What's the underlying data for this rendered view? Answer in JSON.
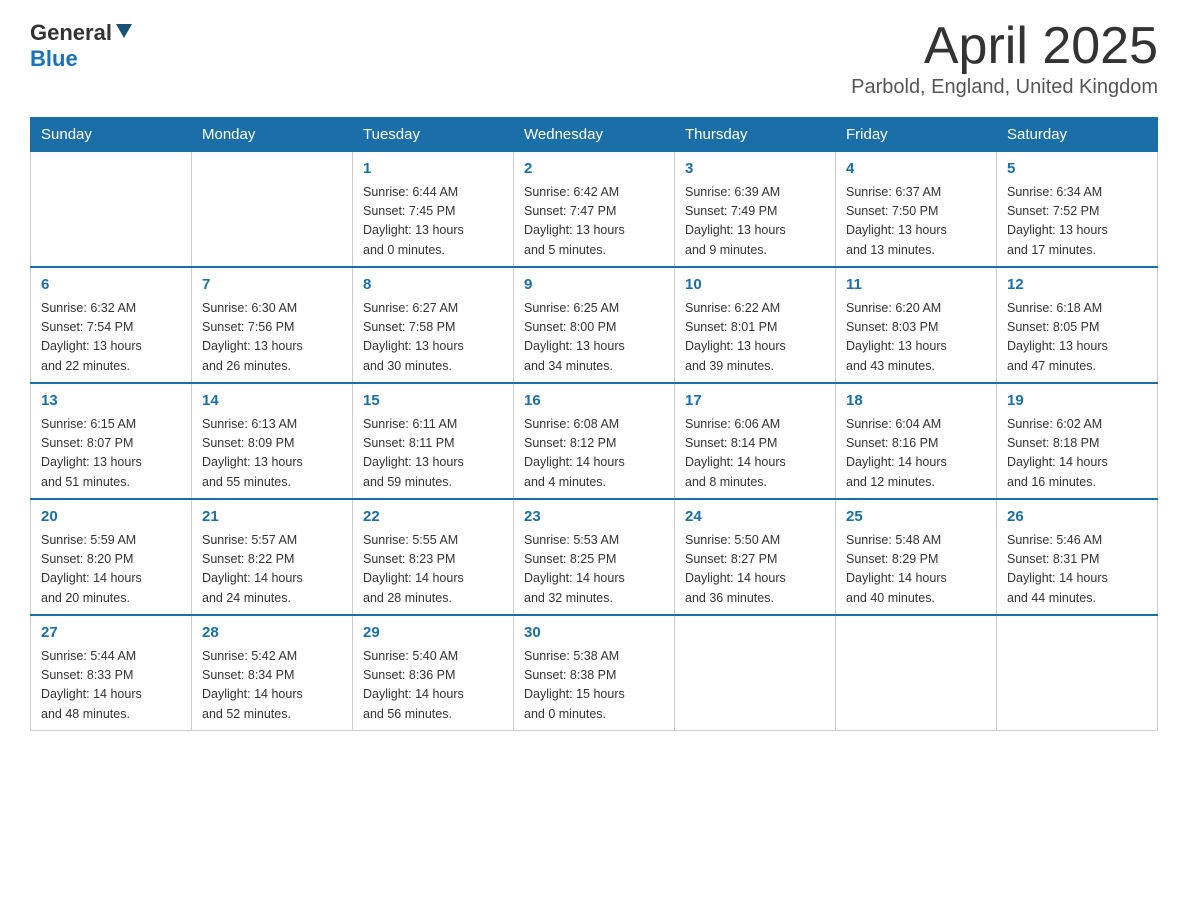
{
  "header": {
    "logo_general": "General",
    "logo_blue": "Blue",
    "month_title": "April 2025",
    "location": "Parbold, England, United Kingdom"
  },
  "days_of_week": [
    "Sunday",
    "Monday",
    "Tuesday",
    "Wednesday",
    "Thursday",
    "Friday",
    "Saturday"
  ],
  "weeks": [
    [
      {
        "day": "",
        "info": ""
      },
      {
        "day": "",
        "info": ""
      },
      {
        "day": "1",
        "info": "Sunrise: 6:44 AM\nSunset: 7:45 PM\nDaylight: 13 hours\nand 0 minutes."
      },
      {
        "day": "2",
        "info": "Sunrise: 6:42 AM\nSunset: 7:47 PM\nDaylight: 13 hours\nand 5 minutes."
      },
      {
        "day": "3",
        "info": "Sunrise: 6:39 AM\nSunset: 7:49 PM\nDaylight: 13 hours\nand 9 minutes."
      },
      {
        "day": "4",
        "info": "Sunrise: 6:37 AM\nSunset: 7:50 PM\nDaylight: 13 hours\nand 13 minutes."
      },
      {
        "day": "5",
        "info": "Sunrise: 6:34 AM\nSunset: 7:52 PM\nDaylight: 13 hours\nand 17 minutes."
      }
    ],
    [
      {
        "day": "6",
        "info": "Sunrise: 6:32 AM\nSunset: 7:54 PM\nDaylight: 13 hours\nand 22 minutes."
      },
      {
        "day": "7",
        "info": "Sunrise: 6:30 AM\nSunset: 7:56 PM\nDaylight: 13 hours\nand 26 minutes."
      },
      {
        "day": "8",
        "info": "Sunrise: 6:27 AM\nSunset: 7:58 PM\nDaylight: 13 hours\nand 30 minutes."
      },
      {
        "day": "9",
        "info": "Sunrise: 6:25 AM\nSunset: 8:00 PM\nDaylight: 13 hours\nand 34 minutes."
      },
      {
        "day": "10",
        "info": "Sunrise: 6:22 AM\nSunset: 8:01 PM\nDaylight: 13 hours\nand 39 minutes."
      },
      {
        "day": "11",
        "info": "Sunrise: 6:20 AM\nSunset: 8:03 PM\nDaylight: 13 hours\nand 43 minutes."
      },
      {
        "day": "12",
        "info": "Sunrise: 6:18 AM\nSunset: 8:05 PM\nDaylight: 13 hours\nand 47 minutes."
      }
    ],
    [
      {
        "day": "13",
        "info": "Sunrise: 6:15 AM\nSunset: 8:07 PM\nDaylight: 13 hours\nand 51 minutes."
      },
      {
        "day": "14",
        "info": "Sunrise: 6:13 AM\nSunset: 8:09 PM\nDaylight: 13 hours\nand 55 minutes."
      },
      {
        "day": "15",
        "info": "Sunrise: 6:11 AM\nSunset: 8:11 PM\nDaylight: 13 hours\nand 59 minutes."
      },
      {
        "day": "16",
        "info": "Sunrise: 6:08 AM\nSunset: 8:12 PM\nDaylight: 14 hours\nand 4 minutes."
      },
      {
        "day": "17",
        "info": "Sunrise: 6:06 AM\nSunset: 8:14 PM\nDaylight: 14 hours\nand 8 minutes."
      },
      {
        "day": "18",
        "info": "Sunrise: 6:04 AM\nSunset: 8:16 PM\nDaylight: 14 hours\nand 12 minutes."
      },
      {
        "day": "19",
        "info": "Sunrise: 6:02 AM\nSunset: 8:18 PM\nDaylight: 14 hours\nand 16 minutes."
      }
    ],
    [
      {
        "day": "20",
        "info": "Sunrise: 5:59 AM\nSunset: 8:20 PM\nDaylight: 14 hours\nand 20 minutes."
      },
      {
        "day": "21",
        "info": "Sunrise: 5:57 AM\nSunset: 8:22 PM\nDaylight: 14 hours\nand 24 minutes."
      },
      {
        "day": "22",
        "info": "Sunrise: 5:55 AM\nSunset: 8:23 PM\nDaylight: 14 hours\nand 28 minutes."
      },
      {
        "day": "23",
        "info": "Sunrise: 5:53 AM\nSunset: 8:25 PM\nDaylight: 14 hours\nand 32 minutes."
      },
      {
        "day": "24",
        "info": "Sunrise: 5:50 AM\nSunset: 8:27 PM\nDaylight: 14 hours\nand 36 minutes."
      },
      {
        "day": "25",
        "info": "Sunrise: 5:48 AM\nSunset: 8:29 PM\nDaylight: 14 hours\nand 40 minutes."
      },
      {
        "day": "26",
        "info": "Sunrise: 5:46 AM\nSunset: 8:31 PM\nDaylight: 14 hours\nand 44 minutes."
      }
    ],
    [
      {
        "day": "27",
        "info": "Sunrise: 5:44 AM\nSunset: 8:33 PM\nDaylight: 14 hours\nand 48 minutes."
      },
      {
        "day": "28",
        "info": "Sunrise: 5:42 AM\nSunset: 8:34 PM\nDaylight: 14 hours\nand 52 minutes."
      },
      {
        "day": "29",
        "info": "Sunrise: 5:40 AM\nSunset: 8:36 PM\nDaylight: 14 hours\nand 56 minutes."
      },
      {
        "day": "30",
        "info": "Sunrise: 5:38 AM\nSunset: 8:38 PM\nDaylight: 15 hours\nand 0 minutes."
      },
      {
        "day": "",
        "info": ""
      },
      {
        "day": "",
        "info": ""
      },
      {
        "day": "",
        "info": ""
      }
    ]
  ]
}
